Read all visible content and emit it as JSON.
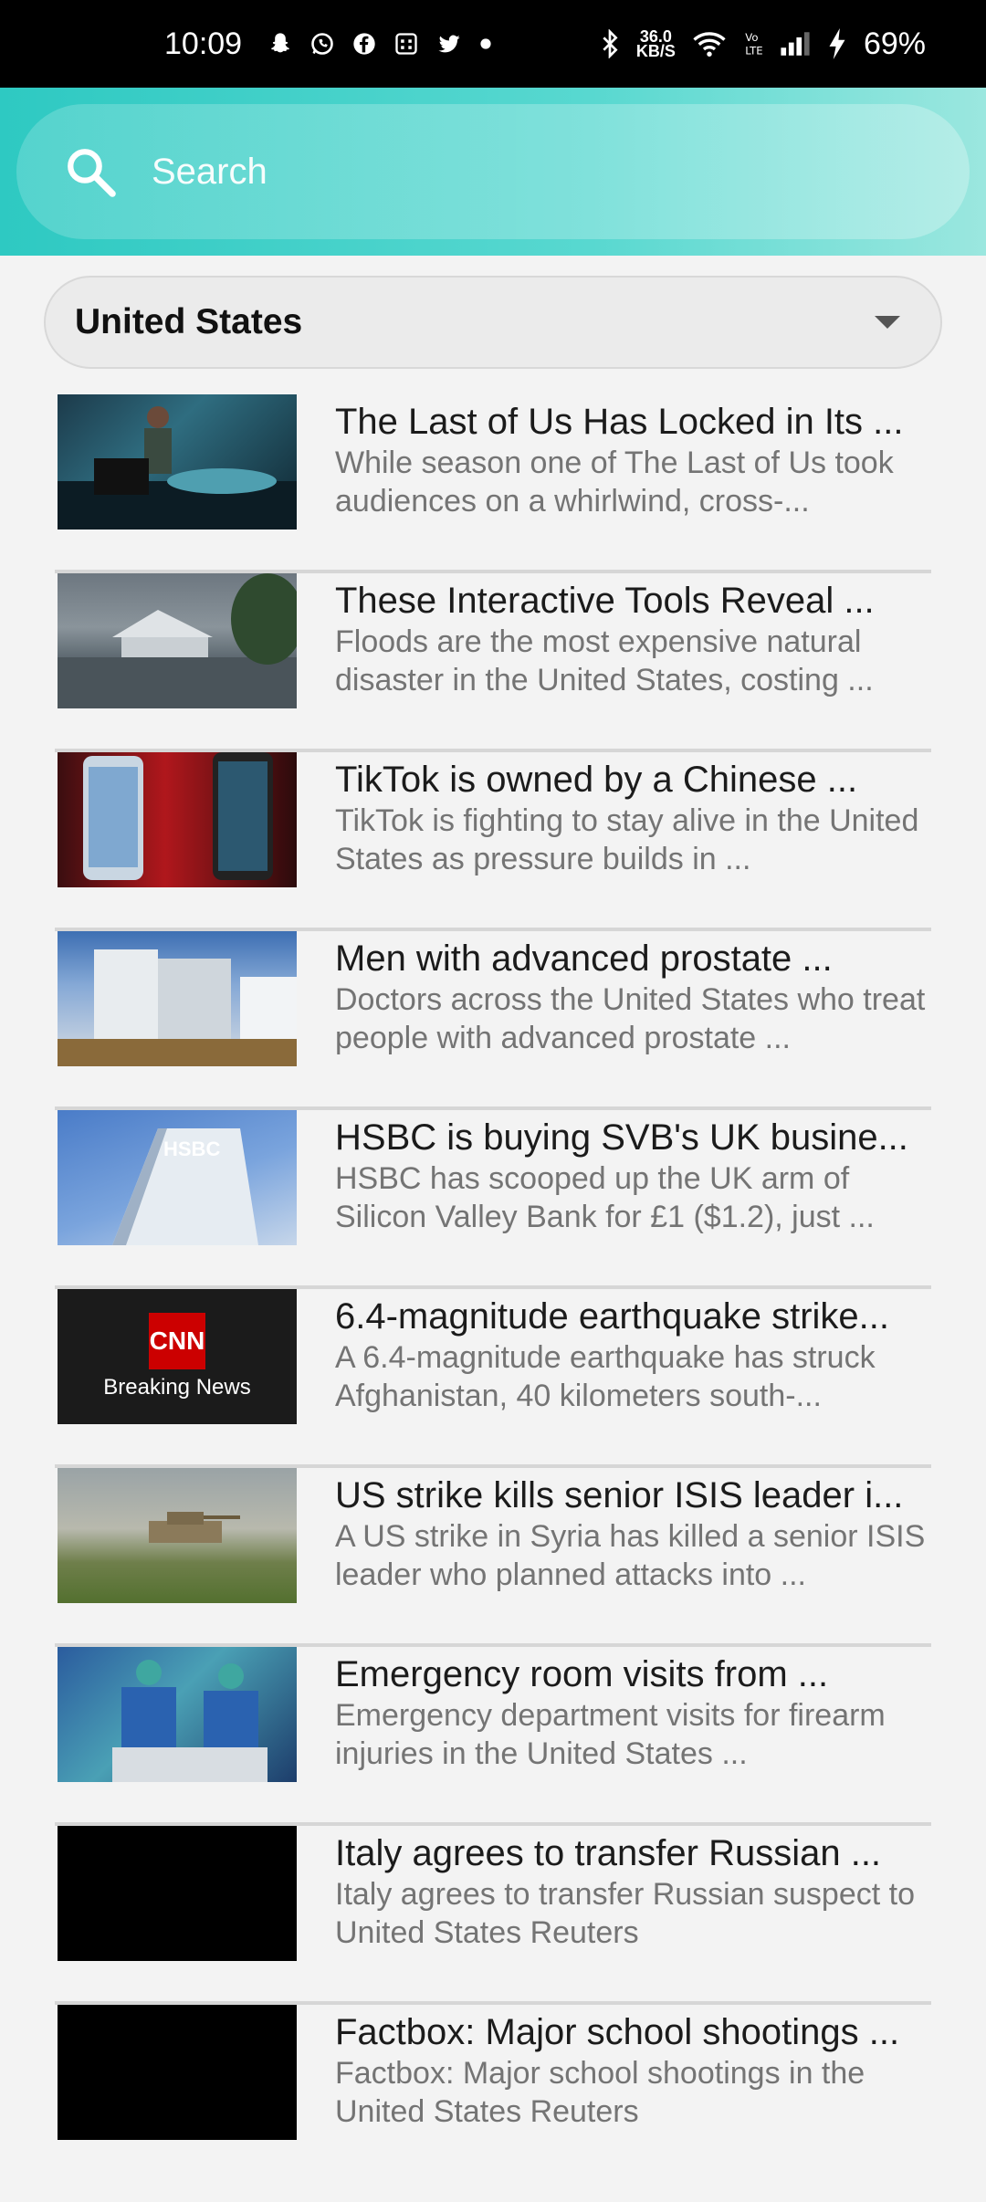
{
  "status_bar": {
    "time": "10:09",
    "notification_icons": [
      "snapchat-icon",
      "whatsapp-icon",
      "facebook-icon",
      "calendar-icon",
      "twitter-icon",
      "dot-icon"
    ],
    "network_speed": "36.0",
    "network_speed_unit": "KB/S",
    "battery": "69%"
  },
  "search": {
    "placeholder": "Search"
  },
  "country_select": {
    "selected": "United States"
  },
  "news": [
    {
      "title": "The Last of Us Has Locked in Its ...",
      "desc": "While season one of The Last of Us took audiences on a whirlwind, cross-...",
      "thumb": "surgery"
    },
    {
      "title": "These Interactive Tools Reveal ...",
      "desc": "Floods are the most expensive natural disaster in the United States, costing ...",
      "thumb": "flood"
    },
    {
      "title": "TikTok is owned by a Chinese ...",
      "desc": "TikTok is fighting to stay alive in the United States as pressure builds in ...",
      "thumb": "tiktok"
    },
    {
      "title": "Men with advanced prostate ...",
      "desc": "Doctors across the United States who treat people with advanced prostate ...",
      "thumb": "building"
    },
    {
      "title": "HSBC is buying SVB's UK busine...",
      "desc": "HSBC has scooped up the UK arm of Silicon Valley Bank for £1 ($1.2), just ...",
      "thumb": "hsbc",
      "thumb_text": "HSBC"
    },
    {
      "title": "6.4-magnitude earthquake strike...",
      "desc": "A 6.4-magnitude earthquake has struck Afghanistan, 40 kilometers south-...",
      "thumb": "cnn",
      "thumb_logo": "CNN",
      "thumb_text": "Breaking News"
    },
    {
      "title": "US strike kills senior ISIS leader i...",
      "desc": "A US strike in Syria has killed a senior ISIS leader who planned attacks into ...",
      "thumb": "tank"
    },
    {
      "title": "Emergency room visits from ...",
      "desc": "Emergency department visits for firearm injuries in the United States ...",
      "thumb": "er"
    },
    {
      "title": "Italy agrees to transfer Russian ...",
      "desc": "Italy agrees to transfer Russian suspect to United States  Reuters",
      "thumb": "black"
    },
    {
      "title": "Factbox: Major school shootings ...",
      "desc": "Factbox: Major school shootings in the United States  Reuters",
      "thumb": "black"
    }
  ],
  "colors": {
    "header_start": "#2ec9c2",
    "header_end": "#9be7df",
    "background": "#f3f3f3"
  }
}
